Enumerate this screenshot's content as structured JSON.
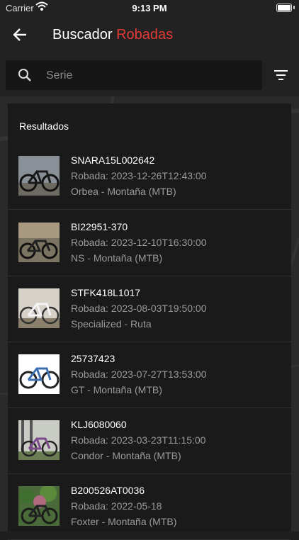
{
  "status": {
    "carrier": "Carrier",
    "time": "9:13 PM"
  },
  "nav": {
    "title_prefix": "Buscador",
    "title_accent": "Robadas",
    "accent_color": "#e53935",
    "back_icon": "arrow-left-icon"
  },
  "search": {
    "placeholder": "Serie",
    "value": "",
    "icon": "search-icon",
    "filter_icon": "filter-icon"
  },
  "results": {
    "header": "Resultados",
    "items": [
      {
        "serial": "SNARA15L002642",
        "stolen": "Robada: 2023-12-26T12:43:00",
        "desc": "Orbea - Montaña (MTB)"
      },
      {
        "serial": "BI22951-370",
        "stolen": "Robada: 2023-12-10T16:30:00",
        "desc": "NS - Montaña (MTB)"
      },
      {
        "serial": "STFK418L1017",
        "stolen": "Robada: 2023-08-03T19:50:00",
        "desc": "Specialized - Ruta"
      },
      {
        "serial": "25737423",
        "stolen": "Robada: 2023-07-27T13:53:00",
        "desc": "GT - Montaña (MTB)"
      },
      {
        "serial": "KLJ6080060",
        "stolen": "Robada: 2023-03-23T11:15:00",
        "desc": "Condor - Montaña (MTB)"
      },
      {
        "serial": "B200526AT0036",
        "stolen": "Robada: 2022-05-18",
        "desc": "Foxter - Montaña (MTB)"
      }
    ]
  }
}
